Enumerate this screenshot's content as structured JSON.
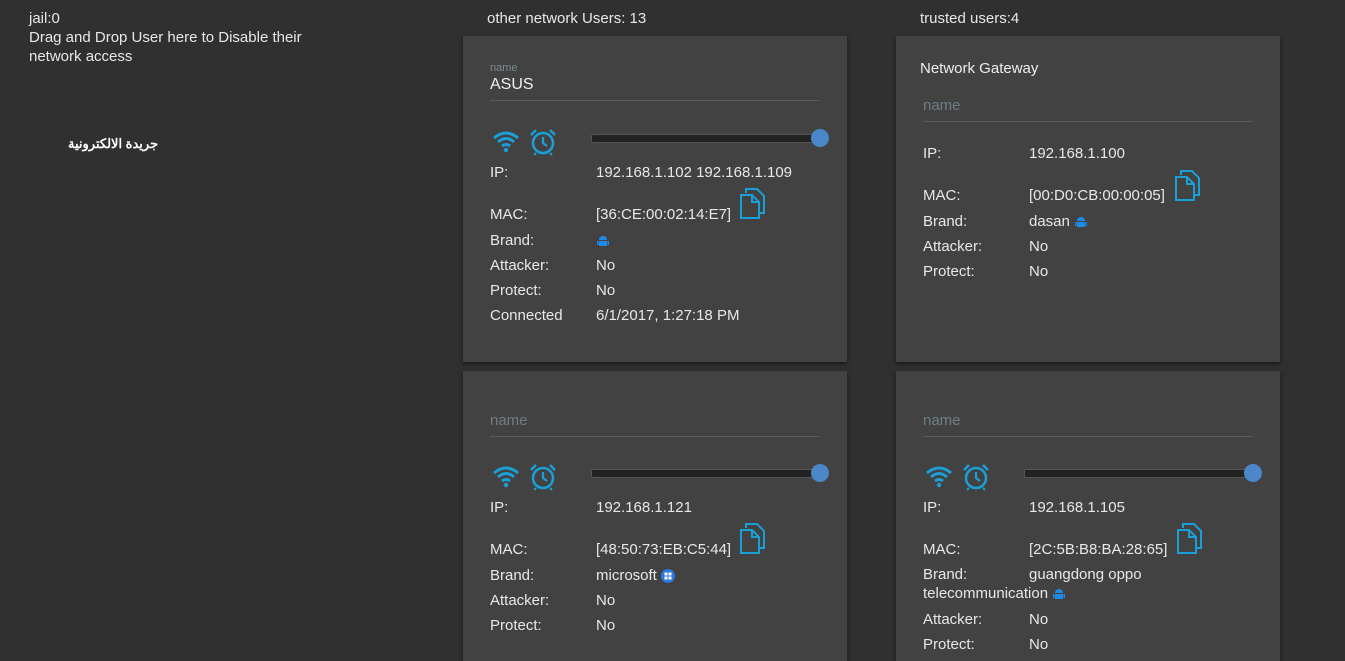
{
  "jail": {
    "title": "jail:0",
    "description": "Drag and Drop User here to Disable their network access"
  },
  "watermark": "جريدة الالكترونية",
  "columns": {
    "other_header": "other network Users: 13",
    "trusted_header": "trusted users:4"
  },
  "labels": {
    "name": "name",
    "ip": "IP:",
    "mac": "MAC:",
    "brand": "Brand:",
    "attacker": "Attacker:",
    "protect": "Protect:",
    "connected": "Connected"
  },
  "cards": {
    "asus": {
      "name": "ASUS",
      "ip": "192.168.1.102 192.168.1.109",
      "mac": "[36:CE:00:02:14:E7]",
      "brand": "",
      "attacker": "No",
      "protect": "No",
      "connected": "6/1/2017, 1:27:18 PM"
    },
    "gateway": {
      "title": "Network Gateway",
      "ip": "192.168.1.100",
      "mac": "[00:D0:CB:00:00:05]",
      "brand": "dasan",
      "attacker": "No",
      "protect": "No"
    },
    "user121": {
      "ip": "192.168.1.121",
      "mac": "[48:50:73:EB:C5:44]",
      "brand": "microsoft",
      "attacker": "No",
      "protect": "No"
    },
    "user105": {
      "ip": "192.168.1.105",
      "mac": "[2C:5B:B8:BA:28:65]",
      "brand": "guangdong oppo telecommunication",
      "attacker": "No",
      "protect": "No"
    }
  },
  "colors": {
    "accent": "#1aa0d8",
    "slider_knob": "#4a86c8",
    "card_bg": "#424242",
    "page_bg": "#303030"
  },
  "icons": [
    "wifi-icon",
    "alarm-clock-icon",
    "copy-icon",
    "android-icon",
    "windows-icon"
  ]
}
